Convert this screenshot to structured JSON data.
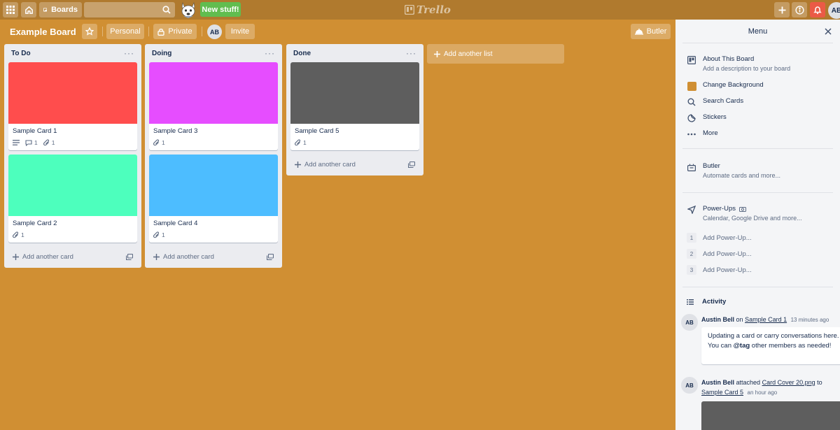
{
  "header": {
    "boards_label": "Boards",
    "search_value": "",
    "new_stuff_label": "New stuff!",
    "logo_text": "Trello",
    "user_initials": "AB"
  },
  "board": {
    "title": "Example Board",
    "personal_label": "Personal",
    "private_label": "Private",
    "member_initials": "AB",
    "invite_label": "Invite",
    "butler_label": "Butler",
    "background_color": "#d08f33"
  },
  "lists": [
    {
      "title": "To Do",
      "add_card_label": "Add another card",
      "cards": [
        {
          "title": "Sample Card 1",
          "cover_color": "#ff4d4d",
          "has_description": true,
          "comments": "1",
          "attachments": "1"
        },
        {
          "title": "Sample Card 2",
          "cover_color": "#4dffbd",
          "has_description": false,
          "comments": "",
          "attachments": "1"
        }
      ]
    },
    {
      "title": "Doing",
      "add_card_label": "Add another card",
      "cards": [
        {
          "title": "Sample Card 3",
          "cover_color": "#e64dff",
          "has_description": false,
          "comments": "",
          "attachments": "1"
        },
        {
          "title": "Sample Card 4",
          "cover_color": "#4dbdff",
          "has_description": false,
          "comments": "",
          "attachments": "1"
        }
      ]
    },
    {
      "title": "Done",
      "add_card_label": "Add another card",
      "cards": [
        {
          "title": "Sample Card 5",
          "cover_color": "#5e5e5e",
          "has_description": false,
          "comments": "",
          "attachments": "1"
        }
      ]
    }
  ],
  "add_list_label": "Add another list",
  "menu": {
    "title": "Menu",
    "about": {
      "title": "About This Board",
      "subtitle": "Add a description to your board"
    },
    "change_background": "Change Background",
    "search_cards": "Search Cards",
    "stickers": "Stickers",
    "more": "More",
    "butler": {
      "title": "Butler",
      "subtitle": "Automate cards and more..."
    },
    "power_ups": {
      "title": "Power-Ups",
      "subtitle": "Calendar, Google Drive and more...",
      "slots": [
        {
          "num": "1",
          "label": "Add Power-Up..."
        },
        {
          "num": "2",
          "label": "Add Power-Up..."
        },
        {
          "num": "3",
          "label": "Add Power-Up..."
        }
      ]
    },
    "activity": {
      "title": "Activity",
      "entries": [
        {
          "initials": "AB",
          "user": "Austin Bell",
          "verb": "on",
          "target": "Sample Card 1",
          "time": "13 minutes ago",
          "comment_pre": "Updating a card or carry conversations here. You can ",
          "comment_tag": "@tag",
          "comment_post": " other members as needed!"
        },
        {
          "initials": "AB",
          "user": "Austin Bell",
          "verb": "attached",
          "target": "Card Cover 20.png",
          "to": "to",
          "target2": "Sample Card 5",
          "time": "an hour ago"
        }
      ]
    }
  }
}
